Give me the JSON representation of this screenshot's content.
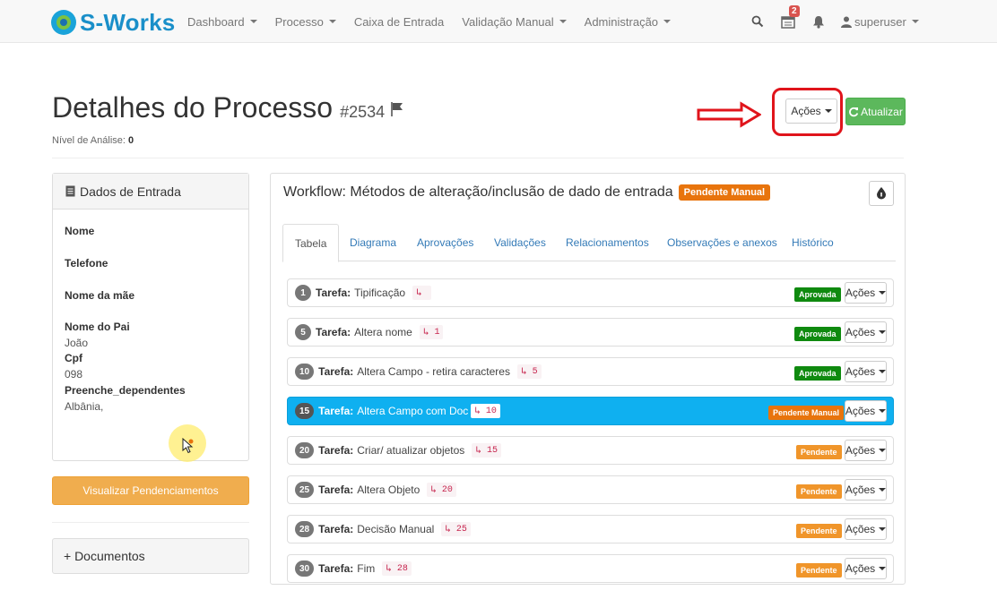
{
  "brand": {
    "name": "S-Works"
  },
  "nav": {
    "items": [
      {
        "label": "Dashboard",
        "dropdown": true
      },
      {
        "label": "Processo",
        "dropdown": true
      },
      {
        "label": "Caixa de Entrada",
        "dropdown": false
      },
      {
        "label": "Validação Manual",
        "dropdown": true
      },
      {
        "label": "Administração",
        "dropdown": true
      }
    ],
    "notification_count": "2",
    "user": "superuser"
  },
  "header": {
    "title": "Detalhes do Processo",
    "process_id": "#2534",
    "nivel_label": "Nível de Análise:",
    "nivel_value": "0",
    "acoes_label": "Ações",
    "atualizar_label": "Atualizar"
  },
  "dados_entrada": {
    "title": "Dados de Entrada",
    "fields": [
      {
        "label": "Nome",
        "value": ""
      },
      {
        "label": "Telefone",
        "value": ""
      },
      {
        "label": "Nome da mãe",
        "value": ""
      },
      {
        "label": "Nome do Pai",
        "value": "João"
      },
      {
        "label": "Cpf",
        "value": "098"
      },
      {
        "label": "Preenche_dependentes",
        "value": "Albânia,"
      }
    ]
  },
  "visualizar_label": "Visualizar Pendenciamentos",
  "documentos_label": "+ Documentos",
  "workflow": {
    "title": "Workflow: Métodos de alteração/inclusão de dado de entrada",
    "status": "Pendente Manual",
    "tabs": [
      {
        "label": "Tabela",
        "active": true
      },
      {
        "label": "Diagrama"
      },
      {
        "label": "Aprovações"
      },
      {
        "label": "Validações"
      },
      {
        "label": "Relacionamentos"
      },
      {
        "label": "Observações e anexos"
      },
      {
        "label": "Histórico"
      }
    ],
    "task_prefix": "Tarefa:",
    "tasks": [
      {
        "num": "1",
        "name": "Tipificação",
        "dep": "",
        "status": "Aprovada"
      },
      {
        "num": "5",
        "name": "Altera nome",
        "dep": "1",
        "status": "Aprovada"
      },
      {
        "num": "10",
        "name": "Altera Campo - retira caracteres",
        "dep": "5",
        "status": "Aprovada"
      },
      {
        "num": "15",
        "name": "Altera Campo com Doc",
        "dep": "10",
        "status": "Pendente Manual",
        "active": true
      },
      {
        "num": "20",
        "name": "Criar/ atualizar objetos",
        "dep": "15",
        "status": "Pendente"
      },
      {
        "num": "25",
        "name": "Altera Objeto",
        "dep": "20",
        "status": "Pendente"
      },
      {
        "num": "28",
        "name": "Decisão Manual",
        "dep": "25",
        "status": "Pendente"
      },
      {
        "num": "30",
        "name": "Fim",
        "dep": "28",
        "status": "Pendente"
      }
    ],
    "row_acoes_label": "Ações"
  },
  "colors": {
    "brand": "#1a8fc9",
    "active_row": "#0fb0f0",
    "aprovada": "#0f8a0f",
    "pendente_manual": "#e8740c",
    "pendente": "#f0952a",
    "atualizar": "#5cb85c",
    "visualizar": "#f0ad4e",
    "highlight": "#e0141b"
  }
}
